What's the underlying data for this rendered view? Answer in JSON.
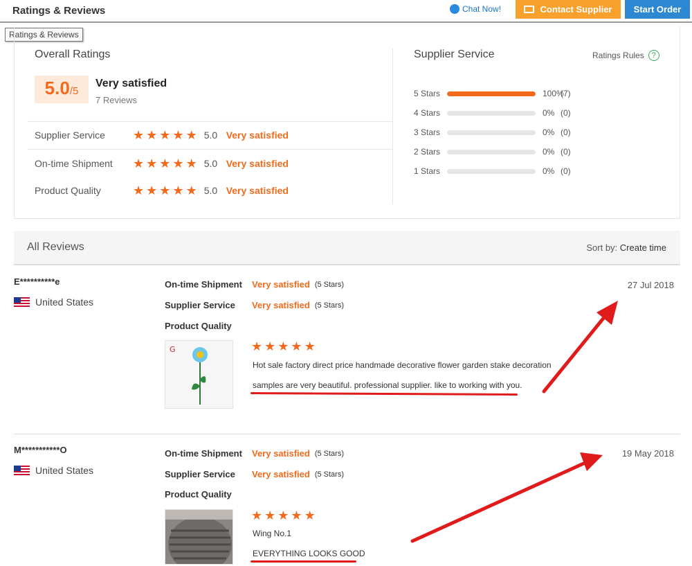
{
  "header": {
    "title": "Ratings & Reviews",
    "chat_label": "Chat Now!",
    "contact_label": "Contact Supplier",
    "start_order_label": "Start Order"
  },
  "tooltip": "Ratings & Reviews",
  "overall": {
    "title": "Overall Ratings",
    "score": "5.0",
    "score_max": "/5",
    "verdict": "Very satisfied",
    "review_count": "7 Reviews",
    "categories": [
      {
        "label": "Supplier Service",
        "value": "5.0",
        "verdict": "Very satisfied"
      },
      {
        "label": "On-time Shipment",
        "value": "5.0",
        "verdict": "Very satisfied"
      },
      {
        "label": "Product Quality",
        "value": "5.0",
        "verdict": "Very satisfied"
      }
    ]
  },
  "supplier_service": {
    "title": "Supplier Service",
    "rules_label": "Ratings Rules",
    "rules_icon": "question-icon",
    "bars": [
      {
        "label": "5 Stars",
        "fill": 1.0,
        "percent": "100%",
        "count": "(7)"
      },
      {
        "label": "4 Stars",
        "fill": 0,
        "percent": "0%",
        "count": "(0)"
      },
      {
        "label": "3 Stars",
        "fill": 0,
        "percent": "0%",
        "count": "(0)"
      },
      {
        "label": "2 Stars",
        "fill": 0,
        "percent": "0%",
        "count": "(0)"
      },
      {
        "label": "1 Stars",
        "fill": 0,
        "percent": "0%",
        "count": "(0)"
      }
    ]
  },
  "all_reviews": {
    "title": "All Reviews",
    "sort_prefix": "Sort by:",
    "sort_value": "Create time"
  },
  "reviews": [
    {
      "reviewer": "E**********e",
      "country": "United States",
      "date": "27 Jul 2018",
      "rows": [
        {
          "label": "On-time Shipment",
          "verdict": "Very satisfied",
          "stars": "(5 Stars)"
        },
        {
          "label": "Supplier Service",
          "verdict": "Very satisfied",
          "stars": "(5 Stars)"
        },
        {
          "label": "Product Quality",
          "verdict": "",
          "stars": ""
        }
      ],
      "product": "Hot sale factory direct price handmade decorative flower garden stake decoration",
      "comment": "samples are very beautiful. professional supplier. like to working with you."
    },
    {
      "reviewer": "M***********O",
      "country": "United States",
      "date": "19 May 2018",
      "rows": [
        {
          "label": "On-time Shipment",
          "verdict": "Very satisfied",
          "stars": "(5 Stars)"
        },
        {
          "label": "Supplier Service",
          "verdict": "Very satisfied",
          "stars": "(5 Stars)"
        },
        {
          "label": "Product Quality",
          "verdict": "",
          "stars": ""
        }
      ],
      "product": "Wing No.1",
      "comment": "EVERYTHING LOOKS GOOD"
    }
  ],
  "colors": {
    "accent": "#f26b1d",
    "contact_button": "#f7a02b",
    "start_button": "#2d87d1",
    "annotation_red": "#e01b1b"
  }
}
